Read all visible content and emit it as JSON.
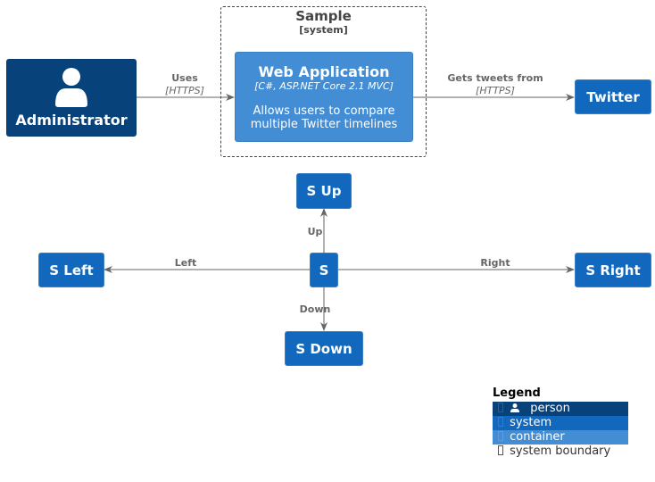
{
  "colors": {
    "person": "#08427B",
    "system": "#1168BD",
    "container": "#438DD5",
    "line": "#666666",
    "boundary": "#444444"
  },
  "boundary": {
    "title": "Sample",
    "type": "[system]"
  },
  "nodes": {
    "administrator": {
      "label": "Administrator",
      "kind": "person",
      "icon": "person-icon"
    },
    "web_application": {
      "label": "Web Application",
      "technology": "[C#, ASP.NET Core 2.1 MVC]",
      "description_line1": "Allows users to compare",
      "description_line2": "multiple Twitter timelines",
      "kind": "container"
    },
    "twitter": {
      "label": "Twitter",
      "kind": "system"
    },
    "s": {
      "label": "S",
      "kind": "system"
    },
    "s_up": {
      "label": "S Up",
      "kind": "system"
    },
    "s_down": {
      "label": "S Down",
      "kind": "system"
    },
    "s_left": {
      "label": "S Left",
      "kind": "system"
    },
    "s_right": {
      "label": "S Right",
      "kind": "system"
    }
  },
  "relations": {
    "uses": {
      "label": "Uses",
      "technology": "[HTTPS]"
    },
    "gets_tweets": {
      "label": "Gets tweets from",
      "technology": "[HTTPS]"
    },
    "up": {
      "label": "Up"
    },
    "down": {
      "label": "Down"
    },
    "left": {
      "label": "Left"
    },
    "right": {
      "label": "Right"
    }
  },
  "legend": {
    "title": "Legend",
    "items": [
      {
        "label": "person",
        "icon": "person-icon",
        "color": "#08427B"
      },
      {
        "label": "system",
        "color": "#1168BD"
      },
      {
        "label": "container",
        "color": "#438DD5"
      },
      {
        "label": "system boundary",
        "color": "#ffffff"
      }
    ]
  }
}
